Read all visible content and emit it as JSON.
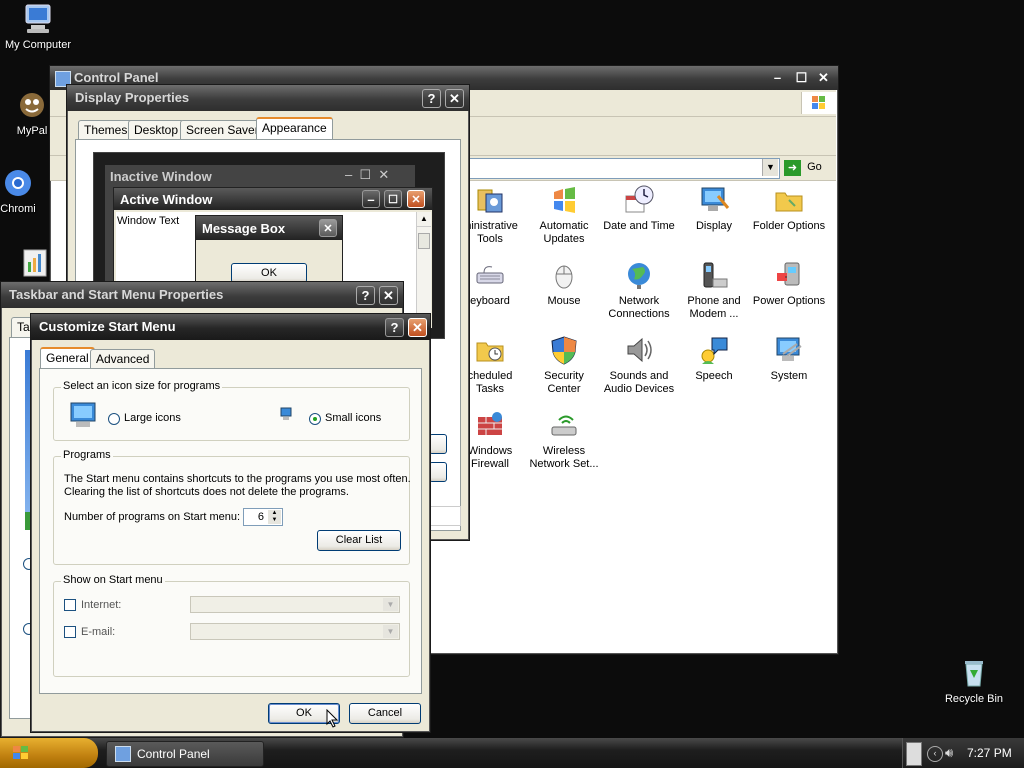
{
  "desktop": {
    "icons": [
      {
        "label": "My Computer",
        "icon": "computer-icon"
      },
      {
        "label": "MyPal",
        "icon": "mypal-icon"
      },
      {
        "label": "Chromi",
        "icon": "chromium-icon"
      },
      {
        "label": "Recycle Bin",
        "icon": "recycle-bin-icon"
      }
    ]
  },
  "control_panel": {
    "title": "Control Panel",
    "address_go": "Go",
    "items": [
      {
        "label": "ministrative\nTools"
      },
      {
        "label": "Automatic\nUpdates"
      },
      {
        "label": "Date and Time"
      },
      {
        "label": "Display"
      },
      {
        "label": "Folder Options"
      },
      {
        "label": "eyboard"
      },
      {
        "label": "Mouse"
      },
      {
        "label": "Network\nConnections"
      },
      {
        "label": "Phone and\nModem ..."
      },
      {
        "label": "Power Options"
      },
      {
        "label": "cheduled\nTasks"
      },
      {
        "label": "Security\nCenter"
      },
      {
        "label": "Sounds and\nAudio Devices"
      },
      {
        "label": "Speech"
      },
      {
        "label": "System"
      },
      {
        "label": "Windows\nFirewall"
      },
      {
        "label": "Wireless\nNetwork Set..."
      }
    ]
  },
  "display_properties": {
    "title": "Display Properties",
    "tabs": [
      "Themes",
      "Desktop",
      "Screen Saver",
      "Appearance"
    ],
    "preview": {
      "inactive_title": "Inactive Window",
      "active_title": "Active Window",
      "window_text": "Window Text",
      "message_box_title": "Message Box",
      "ok": "OK"
    }
  },
  "taskbar_props": {
    "title": "Taskbar and Start Menu Properties"
  },
  "customize": {
    "title": "Customize Start Menu",
    "tabs": [
      "General",
      "Advanced"
    ],
    "icon_size_group": "Select an icon size for programs",
    "large_icons": "Large icons",
    "small_icons": "Small icons",
    "programs_group": "Programs",
    "programs_desc_1": "The Start menu contains shortcuts to the programs you use most often.",
    "programs_desc_2": "Clearing the list of shortcuts does not delete the programs.",
    "num_programs_label": "Number of programs on Start menu:",
    "num_programs_value": "6",
    "clear_list": "Clear List",
    "show_group": "Show on Start menu",
    "internet": "Internet:",
    "email": "E-mail:",
    "ok": "OK",
    "cancel": "Cancel"
  },
  "taskbar": {
    "task_label": "Control Panel",
    "clock": "7:27 PM"
  }
}
